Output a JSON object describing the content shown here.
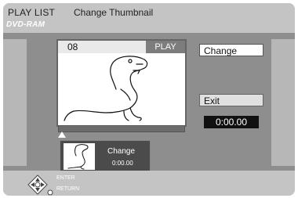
{
  "header": {
    "title": "PLAY LIST",
    "subtitle": "Change Thumbnail",
    "disc": "DVD-RAM"
  },
  "preview": {
    "number": "08",
    "status": "PLAY"
  },
  "thumbnail": {
    "label": "Change",
    "time": "0:00.00"
  },
  "buttons": {
    "change": "Change",
    "exit": "Exit"
  },
  "time_display": "0:00.00",
  "nav": {
    "enter": "ENTER",
    "return": "RETURN"
  },
  "icons": {
    "nav": "remote-navigation-icon",
    "dino": "dinosaur-thumbnail-icon"
  },
  "colors": {
    "background": "#9a9a9a",
    "band": "#c4c4c4",
    "time_box": "#111111"
  }
}
